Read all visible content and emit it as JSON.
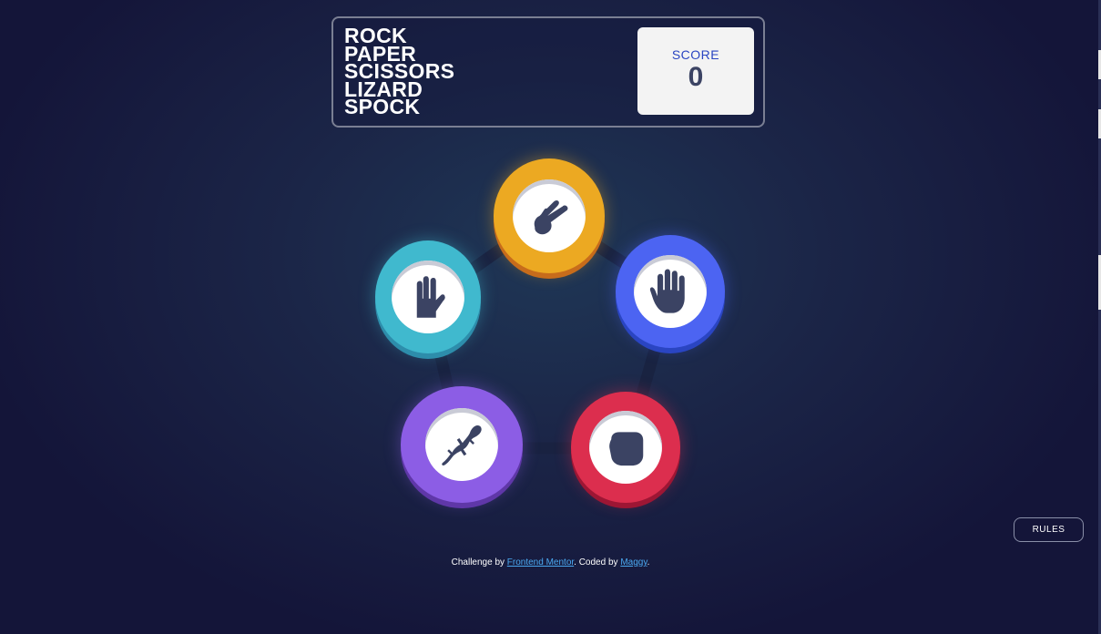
{
  "title_lines": [
    "ROCK",
    "PAPER",
    "SCISSORS",
    "LIZARD",
    "SPOCK"
  ],
  "score": {
    "label": "SCORE",
    "value": "0"
  },
  "tokens": [
    {
      "name": "scissors",
      "color": "#eca922",
      "icon": "scissors-hand-icon"
    },
    {
      "name": "paper",
      "color": "#4c64f2",
      "icon": "paper-hand-icon"
    },
    {
      "name": "rock",
      "color": "#dc2e4e",
      "icon": "rock-fist-icon"
    },
    {
      "name": "lizard",
      "color": "#8c5de5",
      "icon": "lizard-icon"
    },
    {
      "name": "spock",
      "color": "#40b9ce",
      "icon": "spock-hand-icon"
    }
  ],
  "rules_button": {
    "label": "RULES"
  },
  "footer": {
    "prefix": "Challenge by ",
    "link1": "Frontend Mentor",
    "middle": ". Coded by ",
    "link2": "Maggy",
    "suffix": "."
  },
  "colors": {
    "background": "#141539",
    "score_label": "#2a45c2",
    "score_value": "#3b4363",
    "icon_fill": "#3b4363"
  }
}
